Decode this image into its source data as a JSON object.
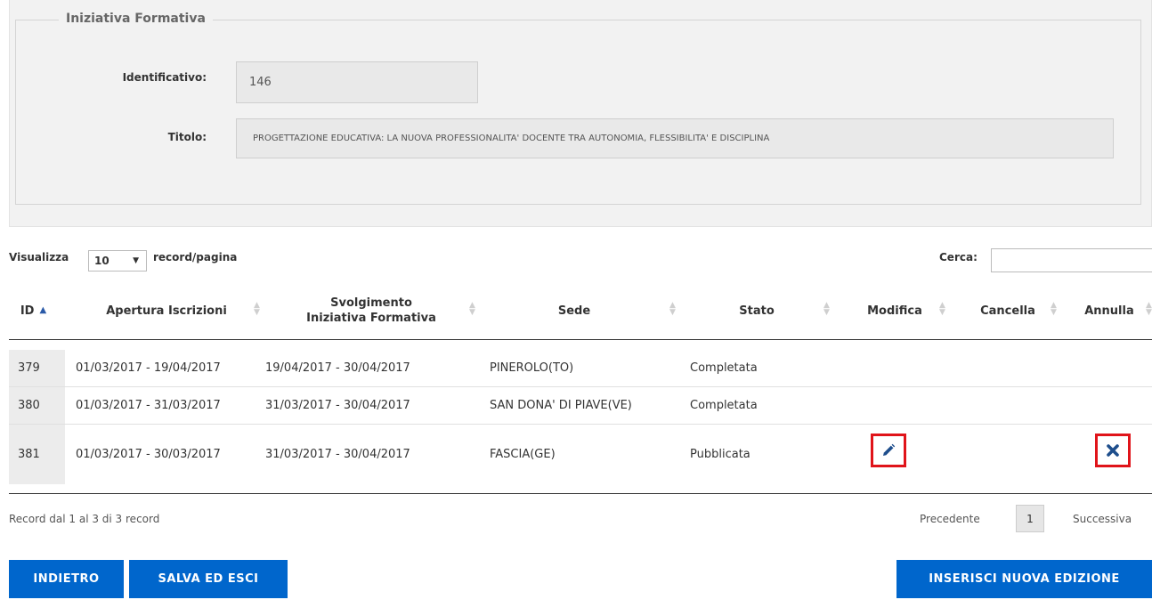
{
  "panel": {
    "legend": "Iniziativa Formativa",
    "id_label": "Identificativo:",
    "id_value": "146",
    "title_label": "Titolo:",
    "title_value": "PROGETTAZIONE EDUCATIVA: LA NUOVA PROFESSIONALITA' DOCENTE TRA AUTONOMIA, FLESSIBILITA' E DISCIPLINA"
  },
  "controls": {
    "show_label": "Visualizza",
    "page_size": "10",
    "per_page_label": "record/pagina",
    "search_label": "Cerca:"
  },
  "table": {
    "headers": {
      "id": "ID",
      "opening_1": "Apertura Iscrizioni",
      "conduct_1": "Svolgimento",
      "conduct_2": "Iniziativa Formativa",
      "site": "Sede",
      "status": "Stato",
      "edit": "Modifica",
      "delete": "Cancella",
      "cancel": "Annulla"
    },
    "rows": [
      {
        "id": "379",
        "opening": "01/03/2017 - 19/04/2017",
        "conduct": "19/04/2017 - 30/04/2017",
        "site": "PINEROLO(TO)",
        "status": "Completata"
      },
      {
        "id": "380",
        "opening": "01/03/2017 - 31/03/2017",
        "conduct": "31/03/2017 - 30/04/2017",
        "site": "SAN DONA' DI PIAVE(VE)",
        "status": "Completata"
      },
      {
        "id": "381",
        "opening": "01/03/2017 - 30/03/2017",
        "conduct": "31/03/2017 - 30/04/2017",
        "site": "FASCIA(GE)",
        "status": "Pubblicata"
      }
    ]
  },
  "footer": {
    "info": "Record dal 1 al 3 di 3 record",
    "prev": "Precedente",
    "page": "1",
    "next": "Successiva"
  },
  "buttons": {
    "back": "INDIETRO",
    "save_exit": "SALVA ED ESCI",
    "new_edition": "INSERISCI NUOVA EDIZIONE"
  },
  "colors": {
    "primary": "#0066cc",
    "highlight": "#e0141a",
    "icon": "#1e4e8c"
  },
  "icons": {
    "edit": "pencil-icon",
    "cancel": "close-icon"
  }
}
